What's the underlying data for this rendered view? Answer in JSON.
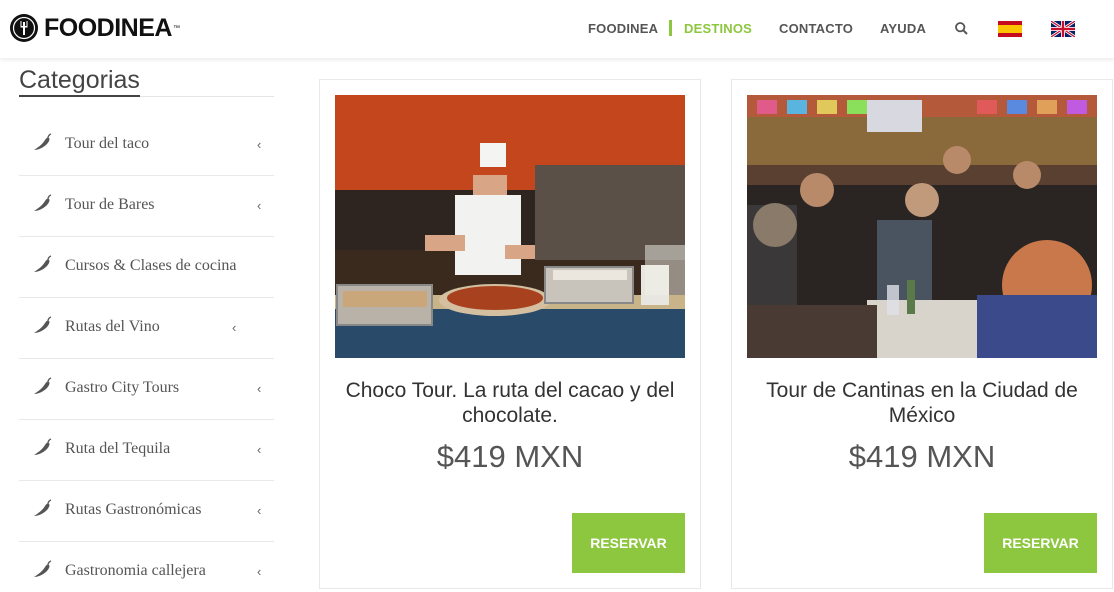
{
  "brand": {
    "name": "FOODINEA",
    "tm": "™"
  },
  "nav": {
    "items": [
      {
        "label": "FOODINEA",
        "active": false
      },
      {
        "label": "DESTINOS",
        "active": true
      },
      {
        "label": "CONTACTO",
        "active": false
      },
      {
        "label": "AYUDA",
        "active": false
      }
    ],
    "search_icon": "search-icon",
    "languages": [
      "spanish-flag",
      "uk-flag"
    ]
  },
  "colors": {
    "accent": "#8dc63f",
    "text": "#333333"
  },
  "sidebar": {
    "title": "Categorias",
    "items": [
      {
        "label": "Tour del taco",
        "has_submenu": true
      },
      {
        "label": "Tour de Bares",
        "has_submenu": true
      },
      {
        "label": "Cursos & Clases de cocina",
        "has_submenu": false
      },
      {
        "label": "Rutas del Vino",
        "has_submenu": true
      },
      {
        "label": "Gastro City Tours",
        "has_submenu": true
      },
      {
        "label": "Ruta del Tequila",
        "has_submenu": true
      },
      {
        "label": "Rutas Gastronómicas",
        "has_submenu": true
      },
      {
        "label": "Gastronomia callejera",
        "has_submenu": true
      }
    ]
  },
  "cards": [
    {
      "title": "Choco Tour. La ruta del cacao y del chocolate.",
      "price": "$419 MXN",
      "button": "RESERVAR"
    },
    {
      "title": "Tour de Cantinas en la Ciudad de México",
      "price": "$419 MXN",
      "button": "RESERVAR"
    }
  ]
}
